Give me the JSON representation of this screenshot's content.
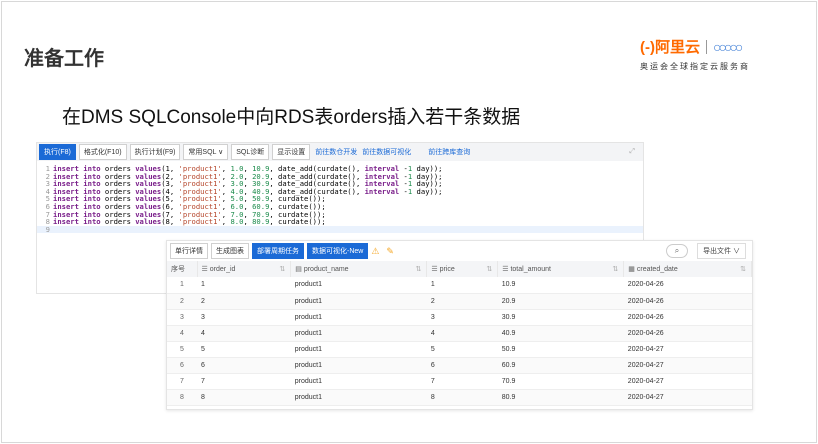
{
  "slide": {
    "title": "准备工作",
    "subtitle": "在DMS SQLConsole中向RDS表orders插入若干条数据"
  },
  "logo": {
    "brand": "(-)阿里云",
    "tagline": "奥运会全球指定云服务商"
  },
  "editor": {
    "toolbar": [
      "执行(F8)",
      "格式化(F10)",
      "执行计划(F9)",
      "常用SQL ∨",
      "SQL诊断",
      "显示设置"
    ],
    "links": [
      "前往数仓开发",
      "前往数据可视化",
      "前往跨库查询"
    ],
    "lines": [
      {
        "id": 1,
        "price": "1.0",
        "total": "10.9",
        "tail": "date_add"
      },
      {
        "id": 2,
        "price": "2.0",
        "total": "20.9",
        "tail": "date_add"
      },
      {
        "id": 3,
        "price": "3.0",
        "total": "30.9",
        "tail": "date_add"
      },
      {
        "id": 4,
        "price": "4.0",
        "total": "40.9",
        "tail": "date_add"
      },
      {
        "id": 5,
        "price": "5.0",
        "total": "50.9",
        "tail": "curdate"
      },
      {
        "id": 6,
        "price": "6.0",
        "total": "60.9",
        "tail": "curdate"
      },
      {
        "id": 7,
        "price": "7.0",
        "total": "70.9",
        "tail": "curdate"
      },
      {
        "id": 8,
        "price": "8.0",
        "total": "80.9",
        "tail": "curdate"
      }
    ]
  },
  "result": {
    "tabs": [
      "单行详情",
      "生成图表",
      "部署周期任务",
      "数据可视化-New"
    ],
    "export": "导出文件 ∨",
    "columns": [
      "序号",
      "order_id",
      "product_name",
      "price",
      "total_amount",
      "created_date"
    ],
    "rows": [
      [
        "1",
        "1",
        "product1",
        "1",
        "10.9",
        "2020-04-26"
      ],
      [
        "2",
        "2",
        "product1",
        "2",
        "20.9",
        "2020-04-26"
      ],
      [
        "3",
        "3",
        "product1",
        "3",
        "30.9",
        "2020-04-26"
      ],
      [
        "4",
        "4",
        "product1",
        "4",
        "40.9",
        "2020-04-26"
      ],
      [
        "5",
        "5",
        "product1",
        "5",
        "50.9",
        "2020-04-27"
      ],
      [
        "6",
        "6",
        "product1",
        "6",
        "60.9",
        "2020-04-27"
      ],
      [
        "7",
        "7",
        "product1",
        "7",
        "70.9",
        "2020-04-27"
      ],
      [
        "8",
        "8",
        "product1",
        "8",
        "80.9",
        "2020-04-27"
      ]
    ]
  }
}
